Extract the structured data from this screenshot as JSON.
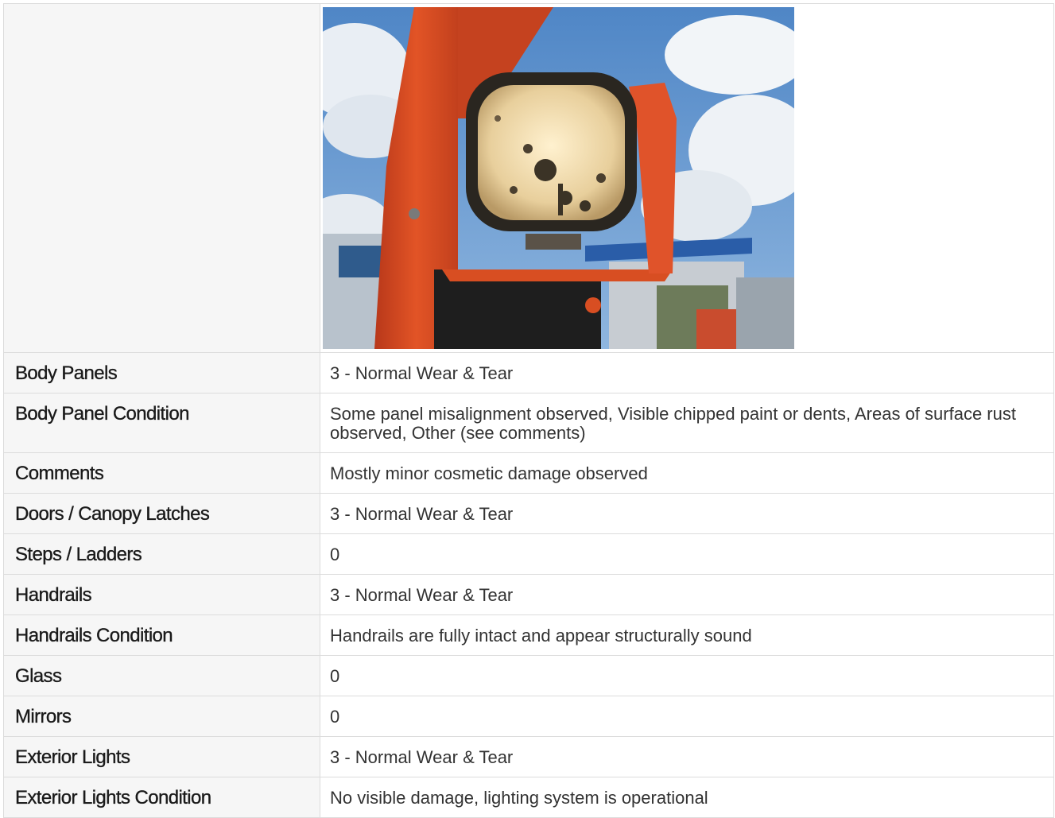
{
  "photo": {
    "icon": "equipment-work-light-photo"
  },
  "colors": {
    "label_bg": "#f6f6f6",
    "border": "#dcdcdc",
    "machine_orange": "#d9481f"
  },
  "rows": [
    {
      "label": "Body Panels",
      "value": "3 - Normal Wear & Tear"
    },
    {
      "label": "Body Panel Condition",
      "value": "Some panel misalignment observed, Visible chipped paint or dents, Areas of surface rust observed, Other (see comments)"
    },
    {
      "label": "Comments",
      "value": "Mostly minor cosmetic damage observed"
    },
    {
      "label": "Doors / Canopy Latches",
      "value": "3 - Normal Wear & Tear"
    },
    {
      "label": "Steps / Ladders",
      "value": "0"
    },
    {
      "label": "Handrails",
      "value": "3 - Normal Wear & Tear"
    },
    {
      "label": "Handrails Condition",
      "value": "Handrails are fully intact and appear structurally sound"
    },
    {
      "label": "Glass",
      "value": "0"
    },
    {
      "label": "Mirrors",
      "value": "0"
    },
    {
      "label": "Exterior Lights",
      "value": "3 - Normal Wear & Tear"
    },
    {
      "label": "Exterior Lights Condition",
      "value": "No visible damage, lighting system is operational"
    }
  ]
}
